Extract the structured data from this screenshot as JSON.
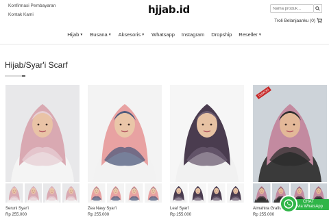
{
  "header": {
    "links": [
      "Konfirmasi Pembayaran",
      "Kontak Kami"
    ],
    "logo": "hjjab.id",
    "search_placeholder": "Nama produk...",
    "cart_label": "Troli Belanjaanku (0)"
  },
  "nav": {
    "items": [
      {
        "label": "Hijab",
        "caret": true
      },
      {
        "label": "Busana",
        "caret": true
      },
      {
        "label": "Aksesoris",
        "caret": true
      },
      {
        "label": "Whatsapp",
        "caret": false
      },
      {
        "label": "Instagram",
        "caret": false
      },
      {
        "label": "Dropship",
        "caret": false
      },
      {
        "label": "Reseller",
        "caret": true
      }
    ]
  },
  "page": {
    "title": "Hijab/Syar'i Scarf"
  },
  "products": [
    {
      "name": "Seruni Syar'i",
      "price": "Rp 255.000",
      "sale": false,
      "colors": {
        "bg": "#e8e8ea",
        "scarf": "#d9a9b2",
        "scarf2": "#e7cfd4",
        "body": "#f4f4f4",
        "face": "#e9c3a6"
      }
    },
    {
      "name": "Zea Navy Syar'i",
      "price": "Rp 255.000",
      "sale": false,
      "colors": {
        "bg": "#f3f3f3",
        "scarf": "#e8a2a2",
        "scarf2": "#4d5a7c",
        "body": "#f2f2f2",
        "face": "#eac6a8"
      }
    },
    {
      "name": "Leaf Syar'i",
      "price": "Rp 255.000",
      "sale": false,
      "colors": {
        "bg": "#f6f6f6",
        "scarf": "#4a3c4f",
        "scarf2": "#6b5b70",
        "body": "#f1f1f1",
        "face": "#e7c2a3"
      }
    },
    {
      "name": "Almahira Grafiti Syar'i",
      "price": "Rp 255.000",
      "sale": true,
      "colors": {
        "bg": "#cdd3d9",
        "scarf": "#c38aa0",
        "scarf2": "#2c2c2c",
        "body": "#3a3a3a",
        "face": "#e3b898"
      }
    }
  ],
  "sale_tag": "DISKON",
  "whatsapp": {
    "line1": "CHAT",
    "line2": "via WhatsApp"
  }
}
